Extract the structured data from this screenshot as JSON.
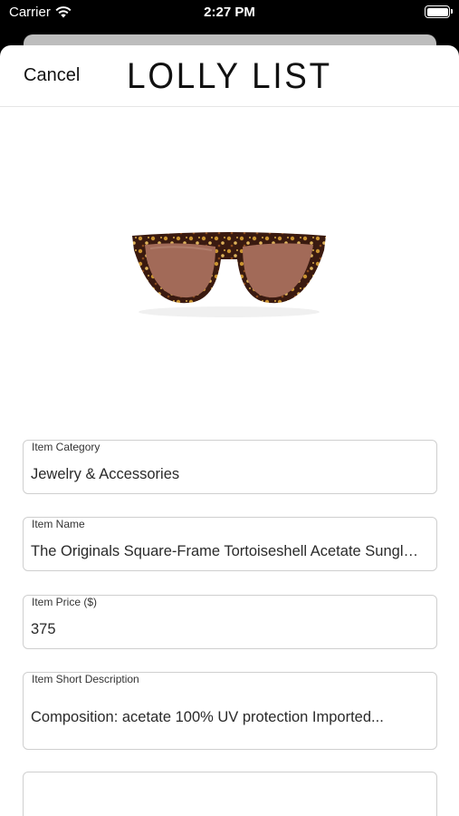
{
  "status_bar": {
    "carrier": "Carrier",
    "time": "2:27 PM"
  },
  "nav": {
    "cancel_label": "Cancel",
    "logo_text": "LOLLY LIST"
  },
  "product": {
    "image": "tortoiseshell-sunglasses"
  },
  "fields": {
    "category": {
      "label": "Item Category",
      "value": "Jewelry & Accessories"
    },
    "name": {
      "label": "Item Name",
      "value": "The Originals Square-Frame Tortoiseshell Acetate Sunglasses"
    },
    "price": {
      "label": "Item Price ($)",
      "value": "375"
    },
    "short_description": {
      "label": "Item Short Description",
      "value": "Composition: acetate  100% UV protection  Imported..."
    }
  }
}
